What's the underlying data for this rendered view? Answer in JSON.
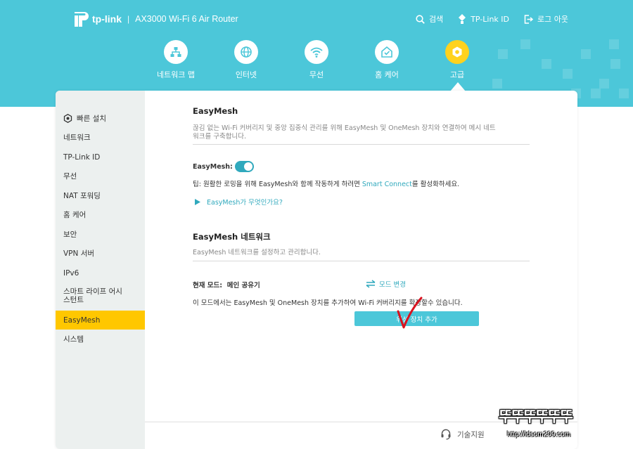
{
  "header": {
    "brand": "tp-link",
    "separator": "|",
    "model": "AX3000 Wi-Fi 6 Air Router",
    "links": [
      {
        "label": "검색",
        "icon": "search-icon"
      },
      {
        "label": "TP-Link ID",
        "icon": "user-diamond-icon"
      },
      {
        "label": "로그 아웃",
        "icon": "logout-icon"
      }
    ]
  },
  "nav": {
    "items": [
      {
        "label": "네트워크 맵",
        "icon": "network-map-icon"
      },
      {
        "label": "인터넷",
        "icon": "globe-icon"
      },
      {
        "label": "무선",
        "icon": "wifi-icon"
      },
      {
        "label": "홈 케어",
        "icon": "home-shield-icon"
      },
      {
        "label": "고급",
        "icon": "gear-icon",
        "active": true
      }
    ]
  },
  "sidebar": {
    "items": [
      {
        "label": "빠른 설치",
        "icon": "quick-setup-icon"
      },
      {
        "label": "네트워크"
      },
      {
        "label": "TP-Link ID"
      },
      {
        "label": "무선"
      },
      {
        "label": "NAT 포워딩"
      },
      {
        "label": "홈 케어"
      },
      {
        "label": "보안"
      },
      {
        "label": "VPN 서버"
      },
      {
        "label": "IPv6"
      },
      {
        "label": "스마트 라이프 어시스턴트",
        "line1": "스마트 라이프 어시",
        "line2": "스턴트"
      },
      {
        "label": "EasyMesh",
        "active": true
      },
      {
        "label": "시스템"
      }
    ]
  },
  "easymesh": {
    "title": "EasyMesh",
    "description": "끊김 없는 Wi-Fi 커버리지 및 중앙 집중식 관리를 위해 EasyMesh 및 OneMesh 장치와 연결하여 메시 네트워크를 구축합니다.",
    "desc_line1": "끊김 없는 Wi-Fi 커버리지 및 중앙 집중식 관리를 위해 EasyMesh 및 OneMesh 장치와 연결하여 메시 네트",
    "desc_line2": "워크를 구축합니다.",
    "toggle_label": "EasyMesh:",
    "toggle_on": true,
    "tip_prefix": "팁: 원활한 로밍을 위해 EasyMesh와 함께 작동하게 하려면 ",
    "tip_link": "Smart Connect",
    "tip_suffix": "를 활성화하세요.",
    "what_link": "EasyMesh가 무엇인가요?"
  },
  "network": {
    "title": "EasyMesh 네트워크",
    "description": "EasyMesh 네트워크를 설정하고 관리합니다.",
    "mode_label": "현재 모드:",
    "mode_value": "메인 공유기",
    "mode_change": "모드 변경",
    "info": "이 모드에서는 EasyMesh 및 OneMesh 장치를 추가하여 Wi-Fi 커버리지를 확장할수 있습니다.",
    "add_button": "위성 장치 추가"
  },
  "footer": {
    "support": "기술지원"
  },
  "watermark": {
    "text": "뚜뚜뚜뚜뚜뚜",
    "url": "http://ldsom209.com"
  },
  "colors": {
    "header_bg": "#4cc7d9",
    "accent": "#30a9bd",
    "active_nav": "#ffd21e",
    "active_side": "#ffc700",
    "check_mark": "#d9121f"
  }
}
